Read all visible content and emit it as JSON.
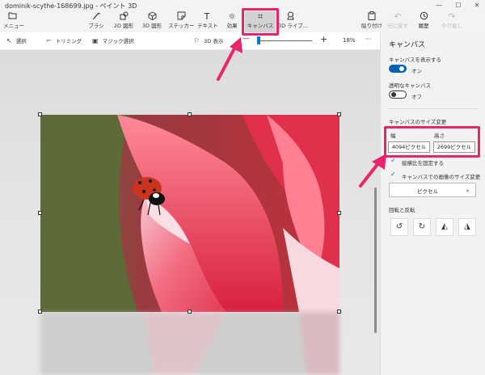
{
  "window": {
    "title": "dominik-scythe-168699.jpg - ペイント 3D",
    "minimize": "—",
    "maximize": "☐",
    "close": "✕"
  },
  "ribbon": {
    "menu": {
      "label": "メニュー",
      "icon": "folder-icon"
    },
    "tools": [
      {
        "label": "ブラシ",
        "icon": "brush-icon"
      },
      {
        "label": "2D 図形",
        "icon": "2d-shapes-icon"
      },
      {
        "label": "3D 図形",
        "icon": "3d-shapes-icon"
      },
      {
        "label": "ステッカー",
        "icon": "sticker-icon"
      },
      {
        "label": "テキスト",
        "icon": "text-icon"
      },
      {
        "label": "効果",
        "icon": "effects-icon"
      },
      {
        "label": "キャンバス",
        "icon": "canvas-icon"
      },
      {
        "label": "3D ライブ...",
        "icon": "3d-library-icon"
      }
    ],
    "right": [
      {
        "label": "貼り付け",
        "icon": "paste-icon"
      },
      {
        "label": "元に戻す",
        "icon": "undo-icon"
      },
      {
        "label": "履歴",
        "icon": "history-icon"
      },
      {
        "label": "やり直し",
        "icon": "redo-icon"
      }
    ]
  },
  "toolbar": {
    "select": "選択",
    "crop": "トリミング",
    "magic_select": "マジック選択",
    "view_3d": "3D 表示",
    "zoom_minus": "—",
    "zoom_plus": "+",
    "zoom_percent": "18%",
    "more": "···"
  },
  "panel": {
    "title": "キャンバス",
    "show_canvas_label": "キャンバスを表示する",
    "show_canvas_state": "オン",
    "show_canvas_on": true,
    "transparent_label": "透明なキャンバス",
    "transparent_state": "オフ",
    "transparent_on": false,
    "resize_title": "キャンバスのサイズ変更",
    "width_label": "幅",
    "height_label": "高さ",
    "width_value": "4094ピクセル",
    "height_value": "2699ピクセル",
    "lock_aspect": "縦横比を固定する",
    "resize_image": "キャンバスでの画像のサイズ変更",
    "unit": "ピクセル",
    "rotate_title": "回転と反転",
    "rotate_buttons": [
      "rotate-left-icon",
      "rotate-right-icon",
      "flip-horizontal-icon",
      "flip-vertical-icon"
    ]
  },
  "colors": {
    "accent": "#0063b1",
    "highlight": "#e8246a"
  }
}
